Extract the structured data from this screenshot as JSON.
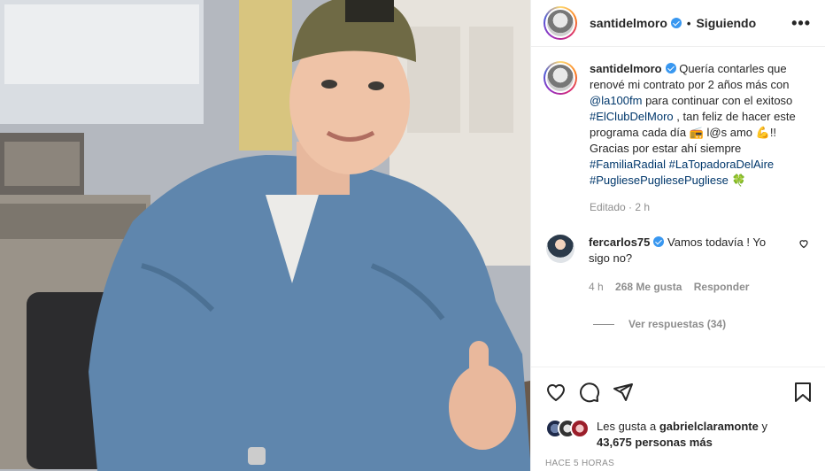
{
  "post": {
    "username": "santidelmoro",
    "follow_status": "Siguiendo",
    "more_label": "•••",
    "caption": {
      "part1": " Quería contarles que renové mi contrato por 2 años más con ",
      "mention": "@la100fm",
      "part2": " para continuar con el exitoso ",
      "tag1": "#ElClubDelMoro",
      "part3": " , tan feliz de hacer este programa cada día 📻 l@s amo 💪!! Gracias por estar ahí siempre ",
      "tag2": "#FamiliaRadial",
      "tag3": "#LaTopadoraDelAire",
      "tag4": "#PugliesePugliesePugliese",
      "emoji_end": " 🍀"
    },
    "edited": "Editado · 2 h"
  },
  "comment": {
    "username": "fercarlos75",
    "text": " Vamos todavía ! Yo sigo no?",
    "age": "4 h",
    "likes": "268 Me gusta",
    "reply": "Responder",
    "view_replies": "Ver respuestas (34)"
  },
  "actions": {
    "likes_prefix": "Les gusta a ",
    "likes_user": "gabrielclaramonte",
    "likes_mid": " y",
    "likes_count": "43,675 personas más",
    "timestamp": "HACE 5 HORAS"
  },
  "icons": [
    "verified-badge",
    "heart-icon",
    "comment-icon",
    "share-icon",
    "save-icon",
    "more-icon"
  ],
  "colors": {
    "link": "#00376b",
    "verified": "#3897f0",
    "muted": "#8e8e8e",
    "text": "#262626"
  }
}
